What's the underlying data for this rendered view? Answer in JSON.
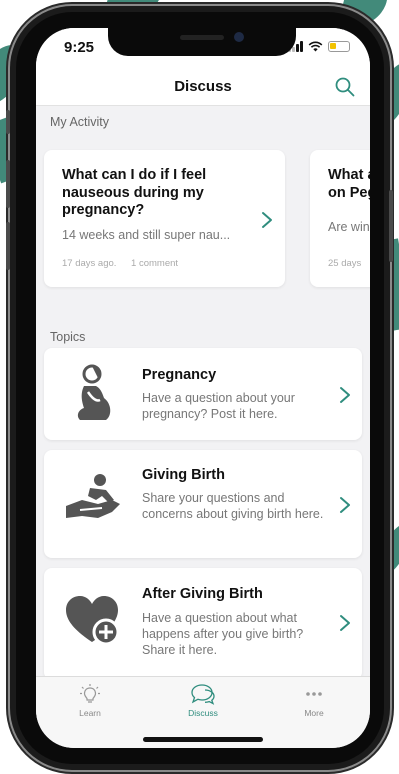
{
  "status_bar": {
    "time": "9:25"
  },
  "nav": {
    "title": "Discuss",
    "search_icon": "search-icon"
  },
  "colors": {
    "accent": "#2f8d7e",
    "background": "#f2f2f4",
    "card": "#ffffff"
  },
  "my_activity": {
    "label": "My Activity",
    "cards": [
      {
        "title": "What can I do if I feel nauseous during my pregnancy?",
        "subtitle": "14 weeks and still super nau...",
        "age": "17 days ago.",
        "comments": "1 comment"
      },
      {
        "title": "What a on Peg",
        "subtitle": "Are win",
        "age": "25 days",
        "comments": ""
      }
    ]
  },
  "topics": {
    "label": "Topics",
    "items": [
      {
        "title": "Pregnancy",
        "description": "Have a question about your pregnancy? Post it here.",
        "icon": "pregnant-woman-icon"
      },
      {
        "title": "Giving Birth",
        "description": "Share your questions and concerns about giving birth here.",
        "icon": "baby-in-hands-icon"
      },
      {
        "title": "After Giving Birth",
        "description": "Have a question about what happens after you give birth? Share it here.",
        "icon": "heart-plus-icon"
      }
    ]
  },
  "tab_bar": {
    "items": [
      {
        "label": "Learn",
        "icon": "lightbulb-icon",
        "active": false
      },
      {
        "label": "Discuss",
        "icon": "chat-bubbles-icon",
        "active": true
      },
      {
        "label": "More",
        "icon": "more-dots-icon",
        "active": false
      }
    ]
  }
}
